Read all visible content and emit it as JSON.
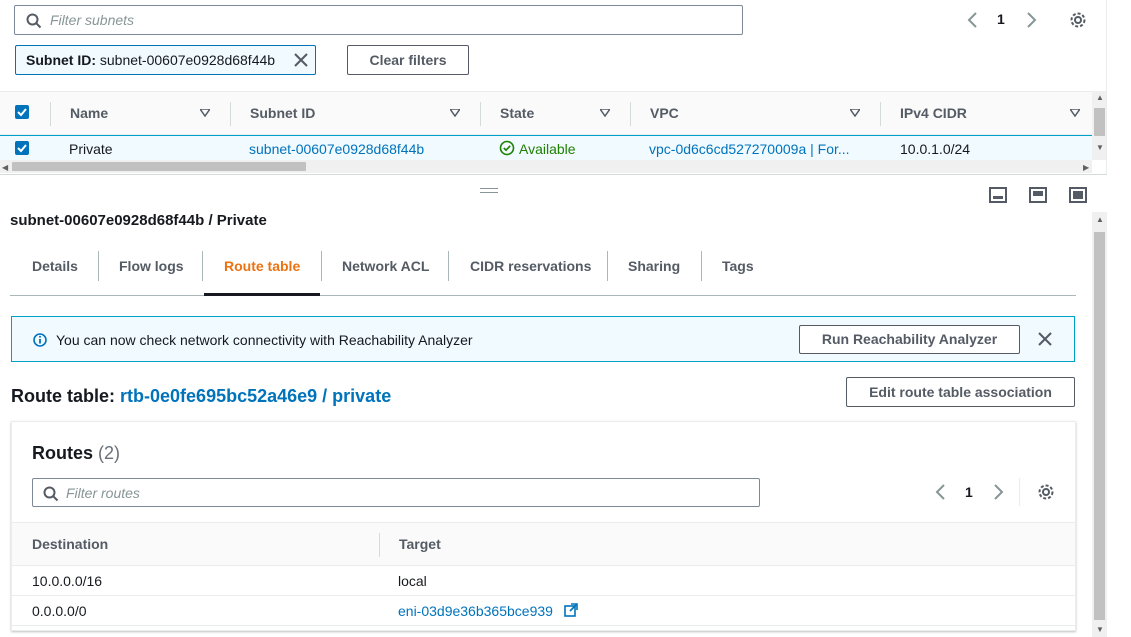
{
  "subnets_panel": {
    "search_placeholder": "Filter subnets",
    "page_number": "1",
    "filter_chip": {
      "key": "Subnet ID:",
      "value": "subnet-00607e0928d68f44b"
    },
    "clear_filters_label": "Clear filters",
    "columns": [
      "Name",
      "Subnet ID",
      "State",
      "VPC",
      "IPv4 CIDR"
    ],
    "row": {
      "name": "Private",
      "subnet_id": "subnet-00607e0928d68f44b",
      "state": "Available",
      "vpc": "vpc-0d6c6cd527270009a | For...",
      "cidr": "10.0.1.0/24"
    }
  },
  "detail_panel": {
    "title": "subnet-00607e0928d68f44b / Private",
    "tabs": [
      "Details",
      "Flow logs",
      "Route table",
      "Network ACL",
      "CIDR reservations",
      "Sharing",
      "Tags"
    ],
    "active_tab": "Route table",
    "flash": {
      "message": "You can now check network connectivity with Reachability Analyzer",
      "button_label": "Run Reachability Analyzer"
    },
    "route_table": {
      "label": "Route table:",
      "link_text": "rtb-0e0fe695bc52a46e9 / private",
      "edit_button_label": "Edit route table association"
    },
    "routes": {
      "heading": "Routes",
      "count": "(2)",
      "search_placeholder": "Filter routes",
      "page_number": "1",
      "columns": [
        "Destination",
        "Target"
      ],
      "rows": [
        {
          "destination": "10.0.0.0/16",
          "target": "local"
        },
        {
          "destination": "0.0.0.0/0",
          "target": "eni-03d9e36b365bce939"
        }
      ]
    }
  },
  "colors": {
    "link": "#0073bb",
    "active_tab": "#ec7211",
    "success": "#1d8102",
    "selection_bg": "#f1faff"
  }
}
